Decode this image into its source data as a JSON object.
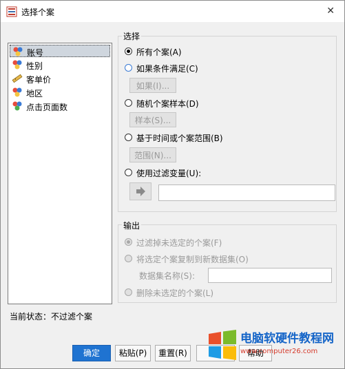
{
  "window": {
    "title": "选择个案"
  },
  "variables": [
    {
      "label": "账号",
      "icon": "nominal-variable-icon",
      "selected": true
    },
    {
      "label": "性别",
      "icon": "nominal-variable-icon",
      "selected": false
    },
    {
      "label": "客单价",
      "icon": "scale-variable-icon",
      "selected": false
    },
    {
      "label": "地区",
      "icon": "nominal-variable-icon",
      "selected": false
    },
    {
      "label": "点击页面数",
      "icon": "ordinal-variable-icon",
      "selected": false
    }
  ],
  "select_group": {
    "title": "选择",
    "all_cases": "所有个案(A)",
    "if_condition": "如果条件满足(C)",
    "if_button": "如果(I)...",
    "random_sample": "随机个案样本(D)",
    "sample_button": "样本(S)...",
    "time_range": "基于时间或个案范围(B)",
    "range_button": "范围(N)...",
    "filter_variable": "使用过滤变量(U):"
  },
  "output_group": {
    "title": "输出",
    "filter_out": "过滤掉未选定的个案(F)",
    "copy_to_dataset": "将选定个案复制到新数据集(O)",
    "dataset_name_label": "数据集名称(S):",
    "dataset_name_value": "",
    "delete_unselected": "删除未选定的个案(L)"
  },
  "status": {
    "text": "当前状态：不过滤个案"
  },
  "buttons": {
    "ok": "确定",
    "paste": "粘贴(P)",
    "reset": "重置(R)",
    "help": "帮助"
  },
  "watermark": {
    "title": "电脑软硬件教程网",
    "url": "www.computer26.com"
  },
  "colors": {
    "primary_button": "#1f73d1",
    "selected_row": "#cfd6de"
  }
}
